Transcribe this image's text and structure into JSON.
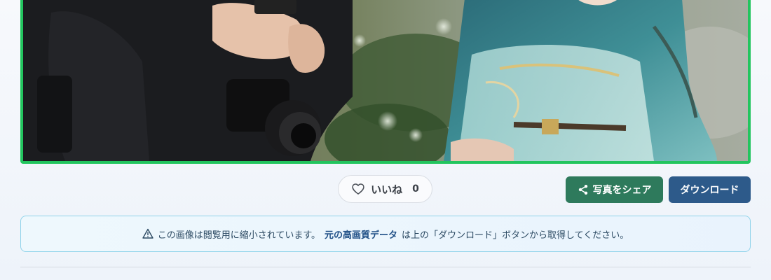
{
  "photo": {
    "alt": "Cosplay photo"
  },
  "actions": {
    "like_label": "いいね",
    "like_count": "0",
    "share_label": "写真をシェア",
    "download_label": "ダウンロード"
  },
  "notice": {
    "prefix": "この画像は閲覧用に縮小されています。",
    "highlight": "元の高画質データ",
    "suffix": "は上の「ダウンロード」ボタンから取得してください。"
  },
  "colors": {
    "frame_border": "#22c55e",
    "share_bg": "#2e7a5c",
    "download_bg": "#2d5a8a",
    "notice_border": "#8fd3ea"
  },
  "icons": {
    "like": "heart-outline-icon",
    "share": "share-icon",
    "notice": "warning-triangle-icon"
  }
}
